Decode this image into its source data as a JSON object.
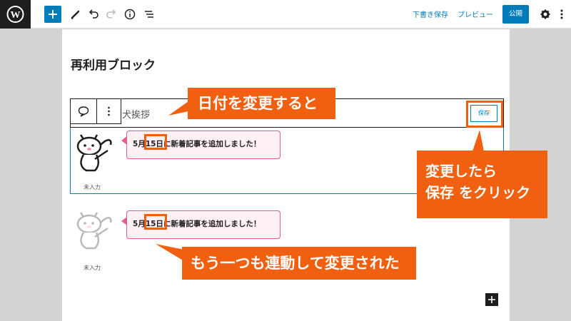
{
  "toolbar": {
    "save_draft": "下書き保存",
    "preview": "プレビュー",
    "publish": "公開"
  },
  "editor": {
    "block_title": "再利用ブロック",
    "reusable_name": "犬挨拶",
    "save_button": "保存",
    "balloon_1": {
      "prefix": "5月",
      "date": "15日",
      "suffix": "に新着記事を追加しました！",
      "avatar_label": "未入力"
    },
    "balloon_2": {
      "prefix": "5月",
      "date": "15日",
      "suffix": "に新着記事を追加しました！",
      "avatar_label": "未入力"
    }
  },
  "annotations": {
    "callout_1": "日付を変更すると",
    "callout_2_line1": "変更したら",
    "callout_2_line2": "保存 をクリック",
    "callout_3": "もう一つも連動して変更された"
  },
  "colors": {
    "wp_blue": "#007cba",
    "annotation_orange": "#f06010",
    "balloon_border": "#e85d85",
    "balloon_fill": "#fff0f3"
  },
  "icons": [
    "wordpress-icon",
    "plus-icon",
    "pen-icon",
    "undo-icon",
    "redo-icon",
    "info-icon",
    "list-view-icon",
    "gear-icon",
    "more-icon",
    "comment-icon"
  ]
}
